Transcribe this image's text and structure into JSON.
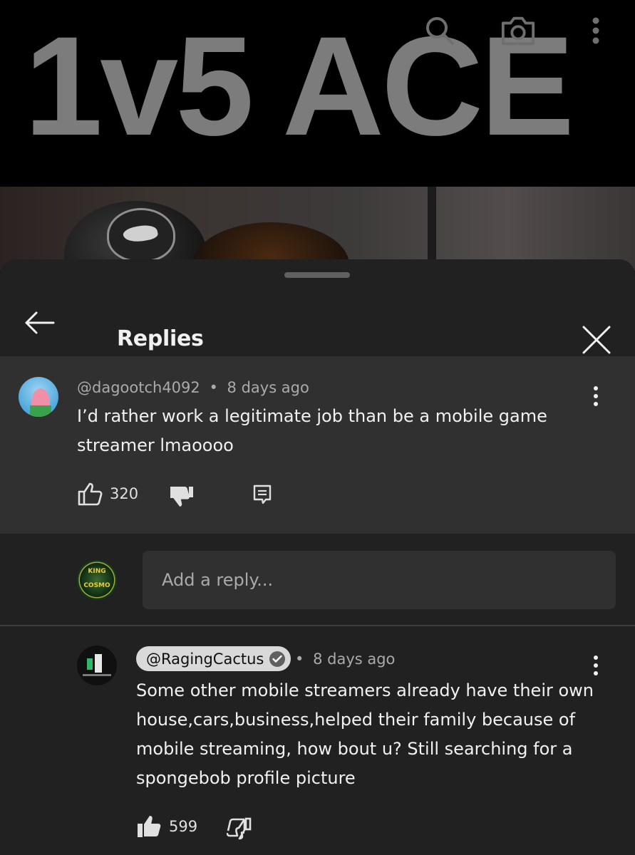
{
  "video": {
    "overlay_text": "1v5 ACE",
    "icons": [
      "search-icon",
      "camera-icon",
      "more-vert-icon"
    ]
  },
  "sheet": {
    "title": "Replies",
    "back_icon": "arrow-left-icon",
    "close_icon": "close-icon"
  },
  "parent_comment": {
    "author": "@dagootch4092",
    "separator": "•",
    "time": "8 days ago",
    "text": "I’d rather work a legitimate job than be a mobile game streamer lmaoooo",
    "likes": "320",
    "icons": [
      "thumb-up-outline-icon",
      "thumb-down-filled-icon",
      "reply-icon"
    ]
  },
  "reply_box": {
    "placeholder": "Add a reply...",
    "avatar_text": [
      "KING",
      "COSMO"
    ]
  },
  "reply": {
    "author": "@RagingCactus",
    "verified": true,
    "separator": "•",
    "time": "8 days ago",
    "text": "Some other mobile streamers already have their own house,cars,business,helped their family because of mobile streaming, how bout u? Still searching for a spongebob profile picture",
    "likes": "599",
    "icons": [
      "thumb-up-filled-icon",
      "thumb-down-outline-icon"
    ]
  },
  "colors": {
    "sheet_bg": "#212121",
    "highlight_bg": "#303030",
    "text_primary": "#f1f1f1",
    "text_secondary": "#aaaaaa",
    "author_chip": "#d9d9d9"
  }
}
